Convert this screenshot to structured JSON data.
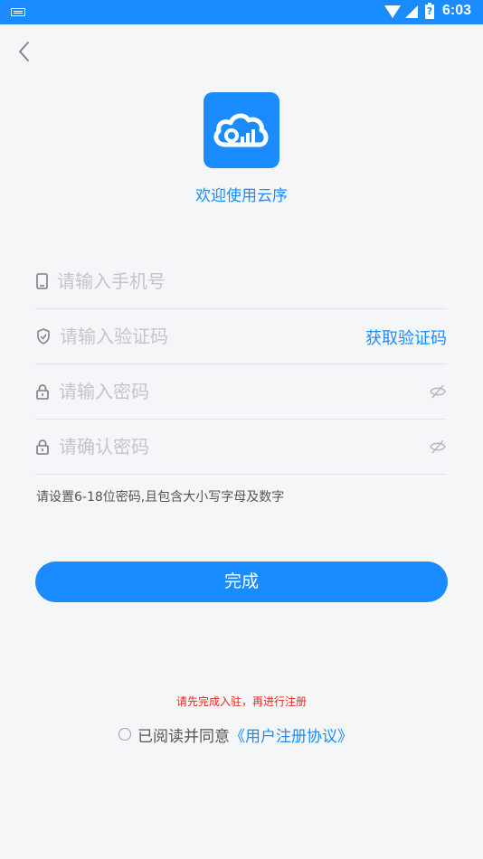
{
  "status_bar": {
    "time": "6:03",
    "battery_label": "?"
  },
  "welcome": "欢迎使用云序",
  "form": {
    "phone_placeholder": "请输入手机号",
    "code_placeholder": "请输入验证码",
    "get_code_label": "获取验证码",
    "password_placeholder": "请输入密码",
    "confirm_placeholder": "请确认密码",
    "password_hint": "请设置6-18位密码,且包含大小写字母及数字"
  },
  "submit_label": "完成",
  "warning": "请先完成入驻，再进行注册",
  "agreement": {
    "prefix": "已阅读并同意",
    "link": "《用户注册协议》"
  },
  "colors": {
    "accent": "#1a8cff",
    "warning": "#e6281e"
  },
  "icons": [
    "keyboard-icon",
    "wifi-icon",
    "signal-icon",
    "battery-icon",
    "back-arrow-icon",
    "cloud-logo-icon",
    "phone-icon",
    "shield-icon",
    "lock-icon",
    "eye-off-icon"
  ]
}
